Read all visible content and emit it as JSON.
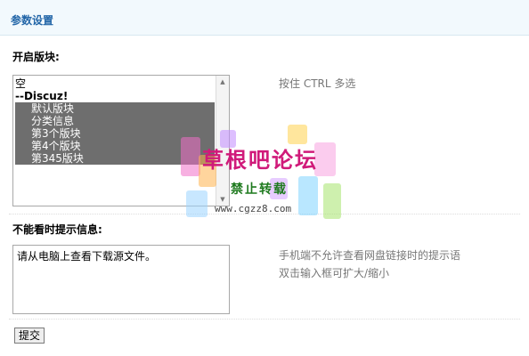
{
  "header": {
    "title": "参数设置"
  },
  "forum_section": {
    "label": "开启版块:",
    "options": [
      {
        "text": "空",
        "type": "plain"
      },
      {
        "text": "--Discuz!",
        "type": "group"
      },
      {
        "text": "默认版块",
        "type": "sub",
        "selected": true
      },
      {
        "text": "分类信息",
        "type": "sub",
        "selected": true
      },
      {
        "text": "第3个版块",
        "type": "sub",
        "selected": true
      },
      {
        "text": "第4个版块",
        "type": "sub",
        "selected": true
      },
      {
        "text": "第345版块",
        "type": "sub",
        "selected": true
      }
    ],
    "hint": "按住 CTRL 多选"
  },
  "message_section": {
    "label": "不能看时提示信息:",
    "value": "请从电脑上查看下载源文件。",
    "hint_line1": "手机端不允许查看网盘链接时的提示语",
    "hint_line2": "双击输入框可扩大/缩小"
  },
  "submit_label": "提交",
  "watermark": {
    "title": "草根吧论坛",
    "subtitle": "禁止转载",
    "url": "www.cgzz8.com"
  },
  "colors": {
    "header_text": "#2366a8",
    "header_bg": "#f2f9fd",
    "selected_bg": "#6e6e6e",
    "watermark_title": "#d01a7a",
    "watermark_sub": "#1e7a1e"
  },
  "icons": {
    "scroll_up": "triangle-up",
    "scroll_down": "triangle-down"
  }
}
